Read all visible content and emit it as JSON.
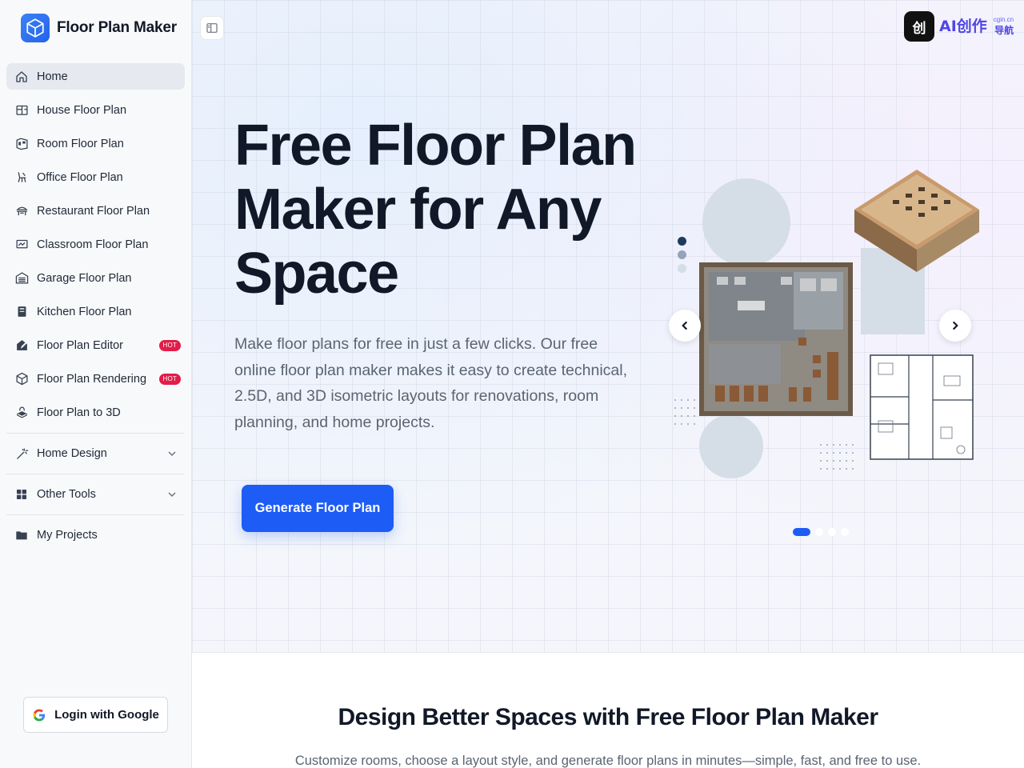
{
  "brand": {
    "name": "Floor Plan Maker"
  },
  "sidebar": {
    "items": [
      {
        "label": "Home",
        "icon": "home-icon",
        "active": true
      },
      {
        "label": "House Floor Plan",
        "icon": "house-plan-icon"
      },
      {
        "label": "Room Floor Plan",
        "icon": "room-plan-icon"
      },
      {
        "label": "Office Floor Plan",
        "icon": "office-chair-icon"
      },
      {
        "label": "Restaurant Floor Plan",
        "icon": "restaurant-icon"
      },
      {
        "label": "Classroom Floor Plan",
        "icon": "classroom-icon"
      },
      {
        "label": "Garage Floor Plan",
        "icon": "garage-icon"
      },
      {
        "label": "Kitchen Floor Plan",
        "icon": "kitchen-icon"
      },
      {
        "label": "Floor Plan Editor",
        "icon": "edit-icon",
        "badge": "HOT"
      },
      {
        "label": "Floor Plan Rendering",
        "icon": "cube-icon",
        "badge": "HOT"
      },
      {
        "label": "Floor Plan to 3D",
        "icon": "3d-icon"
      }
    ],
    "groups": [
      {
        "label": "Home Design",
        "icon": "magic-wand-icon"
      },
      {
        "label": "Other Tools",
        "icon": "grid-icon"
      }
    ],
    "projects": {
      "label": "My Projects",
      "icon": "folder-icon"
    },
    "login_label": "Login with Google"
  },
  "badge": {
    "text": "AI创作",
    "sub_domain": "cgin.cn",
    "sub_label": "导航",
    "icon_char": "创"
  },
  "hero": {
    "title": "Free Floor Plan Maker for Any Space",
    "description": "Make floor plans for free in just a few clicks. Our free online floor plan maker makes it easy to create technical, 2.5D, and 3D isometric layouts for renovations, room planning, and home projects.",
    "cta_label": "Generate Floor Plan",
    "carousel_slides": 4,
    "carousel_active_index": 0
  },
  "section": {
    "title": "Design Better Spaces with Free Floor Plan Maker",
    "subtitle": "Customize rooms, choose a layout style, and generate floor plans in minutes—simple, fast, and free to use."
  },
  "colors": {
    "accent": "#1d5cf5",
    "hot": "#e11d48",
    "badge": "#4f46e5"
  }
}
